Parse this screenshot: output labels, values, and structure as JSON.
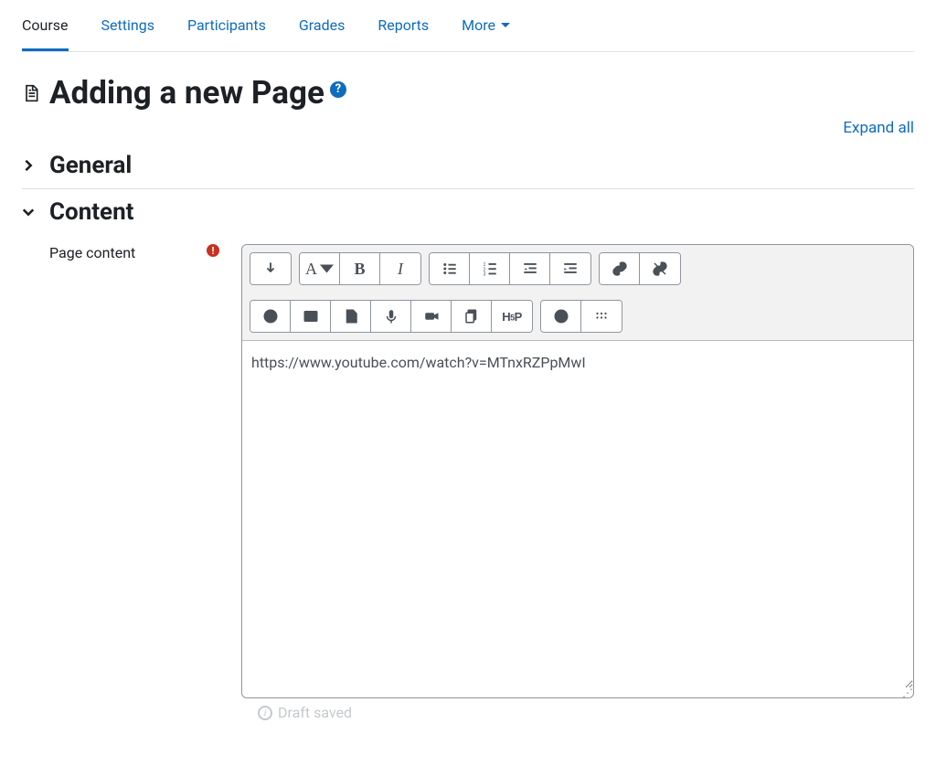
{
  "nav": {
    "tabs": [
      {
        "label": "Course",
        "active": true
      },
      {
        "label": "Settings",
        "active": false
      },
      {
        "label": "Participants",
        "active": false
      },
      {
        "label": "Grades",
        "active": false
      },
      {
        "label": "Reports",
        "active": false
      },
      {
        "label": "More",
        "active": false,
        "dropdown": true
      }
    ]
  },
  "heading": {
    "title": "Adding a new Page",
    "help_tooltip": "?"
  },
  "actions": {
    "expand_all": "Expand all"
  },
  "sections": {
    "general": {
      "title": "General",
      "expanded": false
    },
    "content": {
      "title": "Content",
      "expanded": true
    }
  },
  "content": {
    "label": "Page content",
    "required": true,
    "editor_value": "https://www.youtube.com/watch?v=MTnxRZPpMwI",
    "draft_status": "Draft saved"
  },
  "toolbar": {
    "row1": [
      {
        "group": [
          {
            "name": "toggle-toolbar",
            "icon": "arrow-down"
          }
        ]
      },
      {
        "group": [
          {
            "name": "paragraph-style",
            "icon": "A-caret"
          },
          {
            "name": "bold",
            "icon": "B"
          },
          {
            "name": "italic",
            "icon": "I"
          }
        ]
      },
      {
        "group": [
          {
            "name": "bulleted-list",
            "icon": "ul"
          },
          {
            "name": "numbered-list",
            "icon": "ol"
          },
          {
            "name": "indent",
            "icon": "indent"
          },
          {
            "name": "outdent",
            "icon": "outdent"
          }
        ]
      },
      {
        "group": [
          {
            "name": "link",
            "icon": "link"
          },
          {
            "name": "unlink",
            "icon": "unlink"
          }
        ]
      }
    ],
    "row2": [
      {
        "group": [
          {
            "name": "emoji",
            "icon": "smile"
          },
          {
            "name": "image",
            "icon": "image"
          },
          {
            "name": "media",
            "icon": "file-media"
          },
          {
            "name": "record-audio",
            "icon": "mic"
          },
          {
            "name": "record-video",
            "icon": "video"
          },
          {
            "name": "manage-files",
            "icon": "files"
          },
          {
            "name": "h5p",
            "icon": "h5p"
          }
        ]
      },
      {
        "group": [
          {
            "name": "accessibility-checker",
            "icon": "a11y"
          },
          {
            "name": "screenreader-helper",
            "icon": "braille"
          }
        ]
      }
    ]
  }
}
